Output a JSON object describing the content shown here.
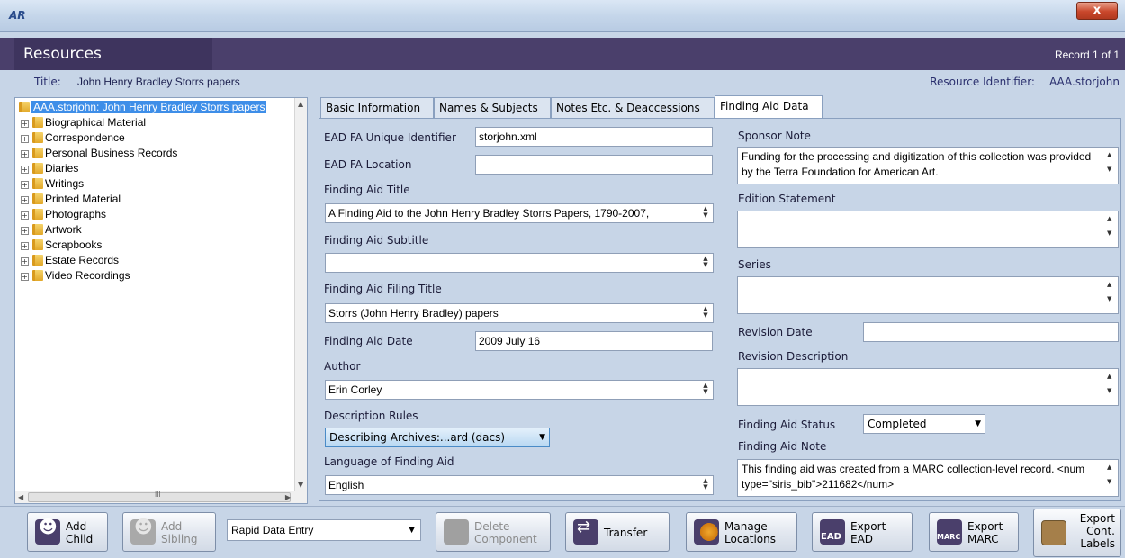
{
  "window": {
    "logo": "AR",
    "close": "x"
  },
  "header": {
    "title": "Resources",
    "record": "Record 1 of 1"
  },
  "info": {
    "title_label": "Title:",
    "title_value": "John Henry Bradley Storrs papers",
    "resid_label": "Resource Identifier:",
    "resid_value": "AAA.storjohn"
  },
  "tree": {
    "root": "AAA.storjohn: John Henry Bradley Storrs papers",
    "items": [
      "Biographical Material",
      "Correspondence",
      "Personal Business Records",
      "Diaries",
      "Writings",
      "Printed Material",
      "Photographs",
      "Artwork",
      "Scrapbooks",
      "Estate Records",
      "Video Recordings"
    ],
    "hscroll_marker": "III"
  },
  "tabs": [
    "Basic Information",
    "Names & Subjects",
    "Notes Etc. & Deaccessions",
    "Finding Aid Data"
  ],
  "left": {
    "unique_id_label": "EAD FA Unique Identifier",
    "unique_id_value": "storjohn.xml",
    "location_label": "EAD FA Location",
    "location_value": "",
    "title_label": "Finding Aid Title",
    "title_value": "A Finding Aid to the John Henry Bradley Storrs Papers, 1790-2007,",
    "subtitle_label": "Finding Aid Subtitle",
    "subtitle_value": "",
    "filing_label": "Finding Aid Filing Title",
    "filing_value": "Storrs (John Henry Bradley) papers",
    "date_label": "Finding Aid Date",
    "date_value": "2009 July 16",
    "author_label": "Author",
    "author_value": "Erin Corley",
    "rules_label": "Description Rules",
    "rules_value": "Describing Archives:...ard (dacs)",
    "language_label": "Language of Finding Aid",
    "language_value": "English"
  },
  "right": {
    "sponsor_label": "Sponsor Note",
    "sponsor_value": "Funding for the processing and digitization of this collection was provided by the Terra Foundation for American Art.",
    "edition_label": "Edition Statement",
    "edition_value": "",
    "series_label": "Series",
    "series_value": "",
    "revdate_label": "Revision Date",
    "revdate_value": "",
    "revdesc_label": "Revision Description",
    "revdesc_value": "",
    "status_label": "Finding Aid Status",
    "status_value": "Completed",
    "note_label": "Finding Aid Note",
    "note_value": "This finding aid was created from a MARC collection-level record. <num type=\"siris_bib\">211682</num>"
  },
  "toolbar": {
    "add_child": [
      "Add",
      "Child"
    ],
    "add_sibling": [
      "Add",
      "Sibling"
    ],
    "rapid_entry": "Rapid Data Entry",
    "delete": [
      "Delete",
      "Component"
    ],
    "transfer": "Transfer",
    "manage": [
      "Manage",
      "Locations"
    ],
    "export_ead": [
      "Export",
      "EAD"
    ],
    "export_marc": [
      "Export",
      "MARC"
    ],
    "export_labels": [
      "Export",
      "Cont.",
      "Labels"
    ]
  }
}
